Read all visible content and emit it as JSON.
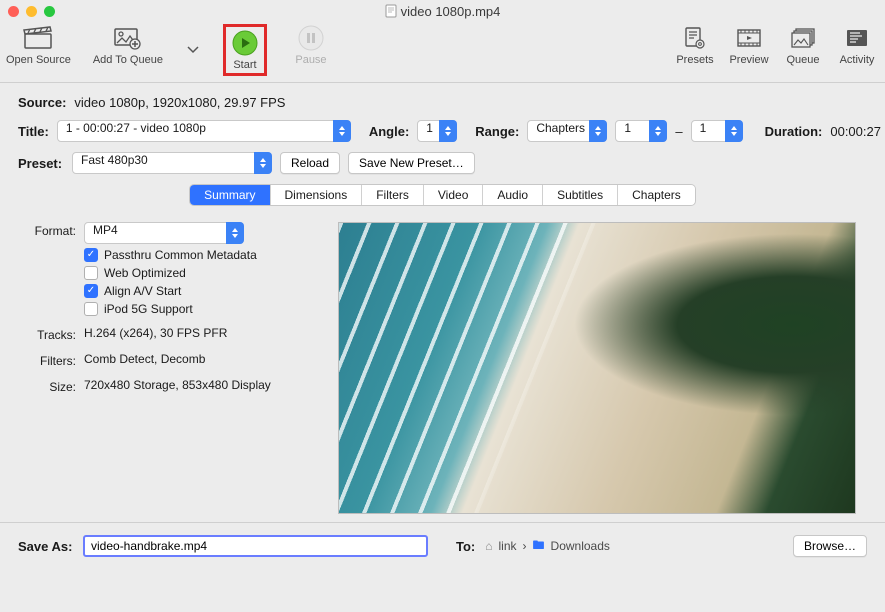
{
  "window": {
    "title": "video 1080p.mp4"
  },
  "toolbar": {
    "open_source": "Open Source",
    "add_to_queue": "Add To Queue",
    "start": "Start",
    "pause": "Pause",
    "presets": "Presets",
    "preview": "Preview",
    "queue": "Queue",
    "activity": "Activity"
  },
  "source": {
    "label": "Source:",
    "value": "video 1080p, 1920x1080, 29.97 FPS"
  },
  "title_row": {
    "label": "Title:",
    "selected": "1 - 00:00:27 - video 1080p",
    "angle_label": "Angle:",
    "angle": "1",
    "range_label": "Range:",
    "range_mode": "Chapters",
    "range_from": "1",
    "dash": "–",
    "range_to": "1",
    "duration_label": "Duration:",
    "duration": "00:00:27"
  },
  "preset_row": {
    "label": "Preset:",
    "selected": "Fast 480p30",
    "reload": "Reload",
    "save_new": "Save New Preset…"
  },
  "tabs": {
    "summary": "Summary",
    "dimensions": "Dimensions",
    "filters": "Filters",
    "video": "Video",
    "audio": "Audio",
    "subtitles": "Subtitles",
    "chapters": "Chapters"
  },
  "summary": {
    "format_label": "Format:",
    "format": "MP4",
    "checks": {
      "passthru": "Passthru Common Metadata",
      "web": "Web Optimized",
      "av": "Align A/V Start",
      "ipod": "iPod 5G Support"
    },
    "tracks_label": "Tracks:",
    "tracks": "H.264 (x264), 30 FPS PFR",
    "filters_label": "Filters:",
    "filters": "Comb Detect, Decomb",
    "size_label": "Size:",
    "size": "720x480 Storage, 853x480 Display"
  },
  "footer": {
    "save_as_label": "Save As:",
    "filename": "video-handbrake.mp4",
    "to_label": "To:",
    "path_link": "link",
    "path_sep": "›",
    "path_downloads": "Downloads",
    "browse": "Browse…"
  }
}
